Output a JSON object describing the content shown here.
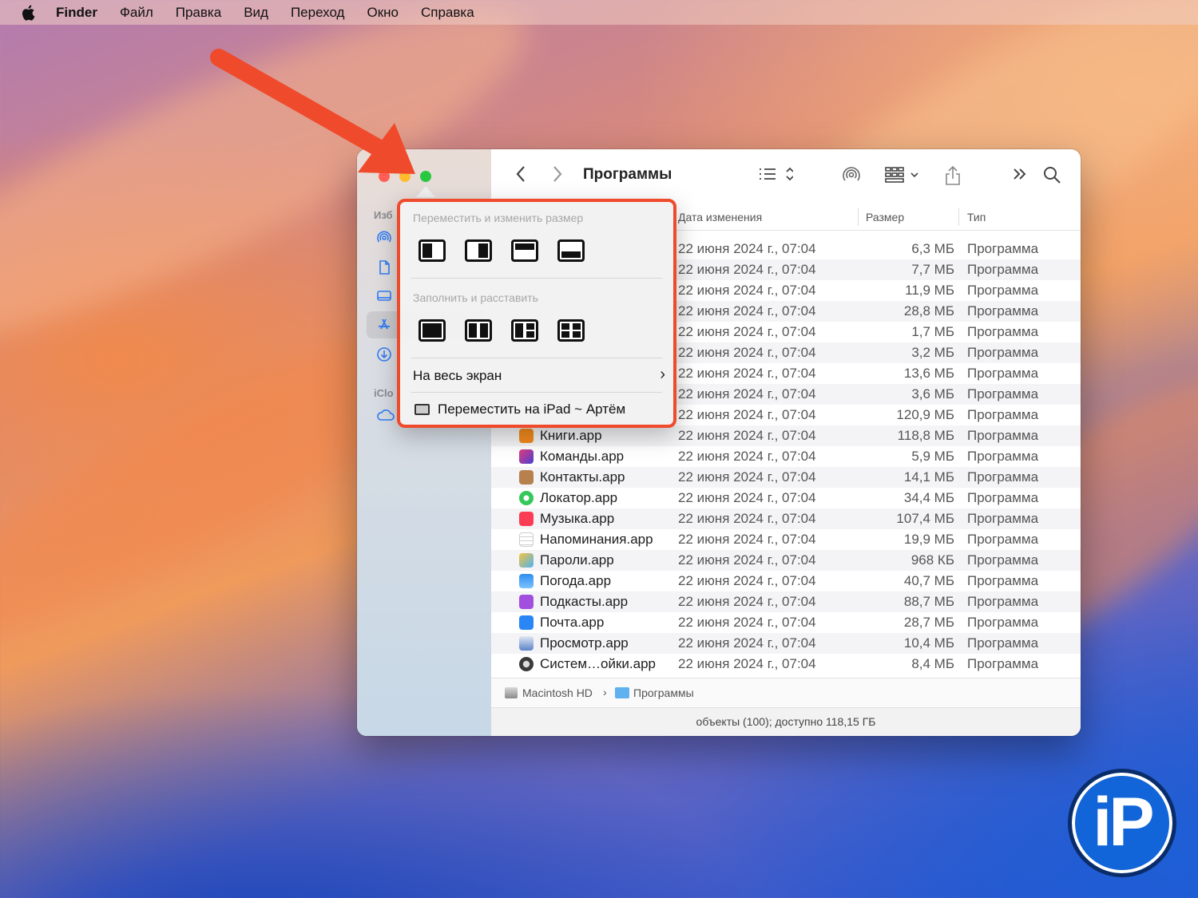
{
  "menubar": {
    "app": "Finder",
    "items": [
      "Файл",
      "Правка",
      "Вид",
      "Переход",
      "Окно",
      "Справка"
    ]
  },
  "window": {
    "title": "Программы",
    "sidebar": {
      "section_favorites": "Изб",
      "section_icloud": "iClo"
    },
    "columns": {
      "date": "Дата изменения",
      "size": "Размер",
      "type": "Тип"
    },
    "rows": [
      {
        "name": "",
        "date": "22 июня 2024 г., 07:04",
        "size": "6,3 МБ",
        "type": "Программа"
      },
      {
        "name": "",
        "date": "22 июня 2024 г., 07:04",
        "size": "7,7 МБ",
        "type": "Программа"
      },
      {
        "name": "",
        "date": "22 июня 2024 г., 07:04",
        "size": "11,9 МБ",
        "type": "Программа"
      },
      {
        "name": "",
        "date": "22 июня 2024 г., 07:04",
        "size": "28,8 МБ",
        "type": "Программа"
      },
      {
        "name": "",
        "date": "22 июня 2024 г., 07:04",
        "size": "1,7 МБ",
        "type": "Программа"
      },
      {
        "name": "",
        "date": "22 июня 2024 г., 07:04",
        "size": "3,2 МБ",
        "type": "Программа"
      },
      {
        "name": "",
        "date": "22 июня 2024 г., 07:04",
        "size": "13,6 МБ",
        "type": "Программа"
      },
      {
        "name": "",
        "date": "22 июня 2024 г., 07:04",
        "size": "3,6 МБ",
        "type": "Программа"
      },
      {
        "name": "",
        "date": "22 июня 2024 г., 07:04",
        "size": "120,9 МБ",
        "type": "Программа"
      },
      {
        "name": "Книги.app",
        "date": "22 июня 2024 г., 07:04",
        "size": "118,8 МБ",
        "type": "Программа",
        "icon_color": "#f28a1e"
      },
      {
        "name": "Команды.app",
        "date": "22 июня 2024 г., 07:04",
        "size": "5,9 МБ",
        "type": "Программа",
        "icon_color": "#6a3fd1"
      },
      {
        "name": "Контакты.app",
        "date": "22 июня 2024 г., 07:04",
        "size": "14,1 МБ",
        "type": "Программа",
        "icon_color": "#b6814f"
      },
      {
        "name": "Локатор.app",
        "date": "22 июня 2024 г., 07:04",
        "size": "34,4 МБ",
        "type": "Программа",
        "icon_color": "#34c759"
      },
      {
        "name": "Музыка.app",
        "date": "22 июня 2024 г., 07:04",
        "size": "107,4 МБ",
        "type": "Программа",
        "icon_color": "#fa3d55"
      },
      {
        "name": "Напоминания.app",
        "date": "22 июня 2024 г., 07:04",
        "size": "19,9 МБ",
        "type": "Программа",
        "icon_color": "#e8e8e8"
      },
      {
        "name": "Пароли.app",
        "date": "22 июня 2024 г., 07:04",
        "size": "968 КБ",
        "type": "Программа",
        "icon_color": "#f5c33b"
      },
      {
        "name": "Погода.app",
        "date": "22 июня 2024 г., 07:04",
        "size": "40,7 МБ",
        "type": "Программа",
        "icon_color": "#2f8ff0"
      },
      {
        "name": "Подкасты.app",
        "date": "22 июня 2024 г., 07:04",
        "size": "88,7 МБ",
        "type": "Программа",
        "icon_color": "#a24fe0"
      },
      {
        "name": "Почта.app",
        "date": "22 июня 2024 г., 07:04",
        "size": "28,7 МБ",
        "type": "Программа",
        "icon_color": "#2a86f5"
      },
      {
        "name": "Просмотр.app",
        "date": "22 июня 2024 г., 07:04",
        "size": "10,4 МБ",
        "type": "Программа",
        "icon_color": "#5b84c9"
      },
      {
        "name": "Систем…ойки.app",
        "date": "22 июня 2024 г., 07:04",
        "size": "8,4 МБ",
        "type": "Программа",
        "icon_color": "#6c6c70"
      }
    ],
    "path": {
      "disk": "Macintosh HD",
      "sep": "›",
      "folder": "Программы"
    },
    "status": "объекты (100); доступно 118,15 ГБ"
  },
  "popup": {
    "section_move": "Переместить и изменить размер",
    "section_fill": "Заполнить и расставить",
    "fullscreen": "На весь экран",
    "fullscreen_chevron": "›",
    "move_ipad": "Переместить на iPad ~ Артём"
  },
  "logo": {
    "text": "iP"
  },
  "colors": {
    "accent_red": "#ef4a2b",
    "close": "#ff5f57",
    "minimize": "#febc2e",
    "maximize": "#28c840"
  }
}
